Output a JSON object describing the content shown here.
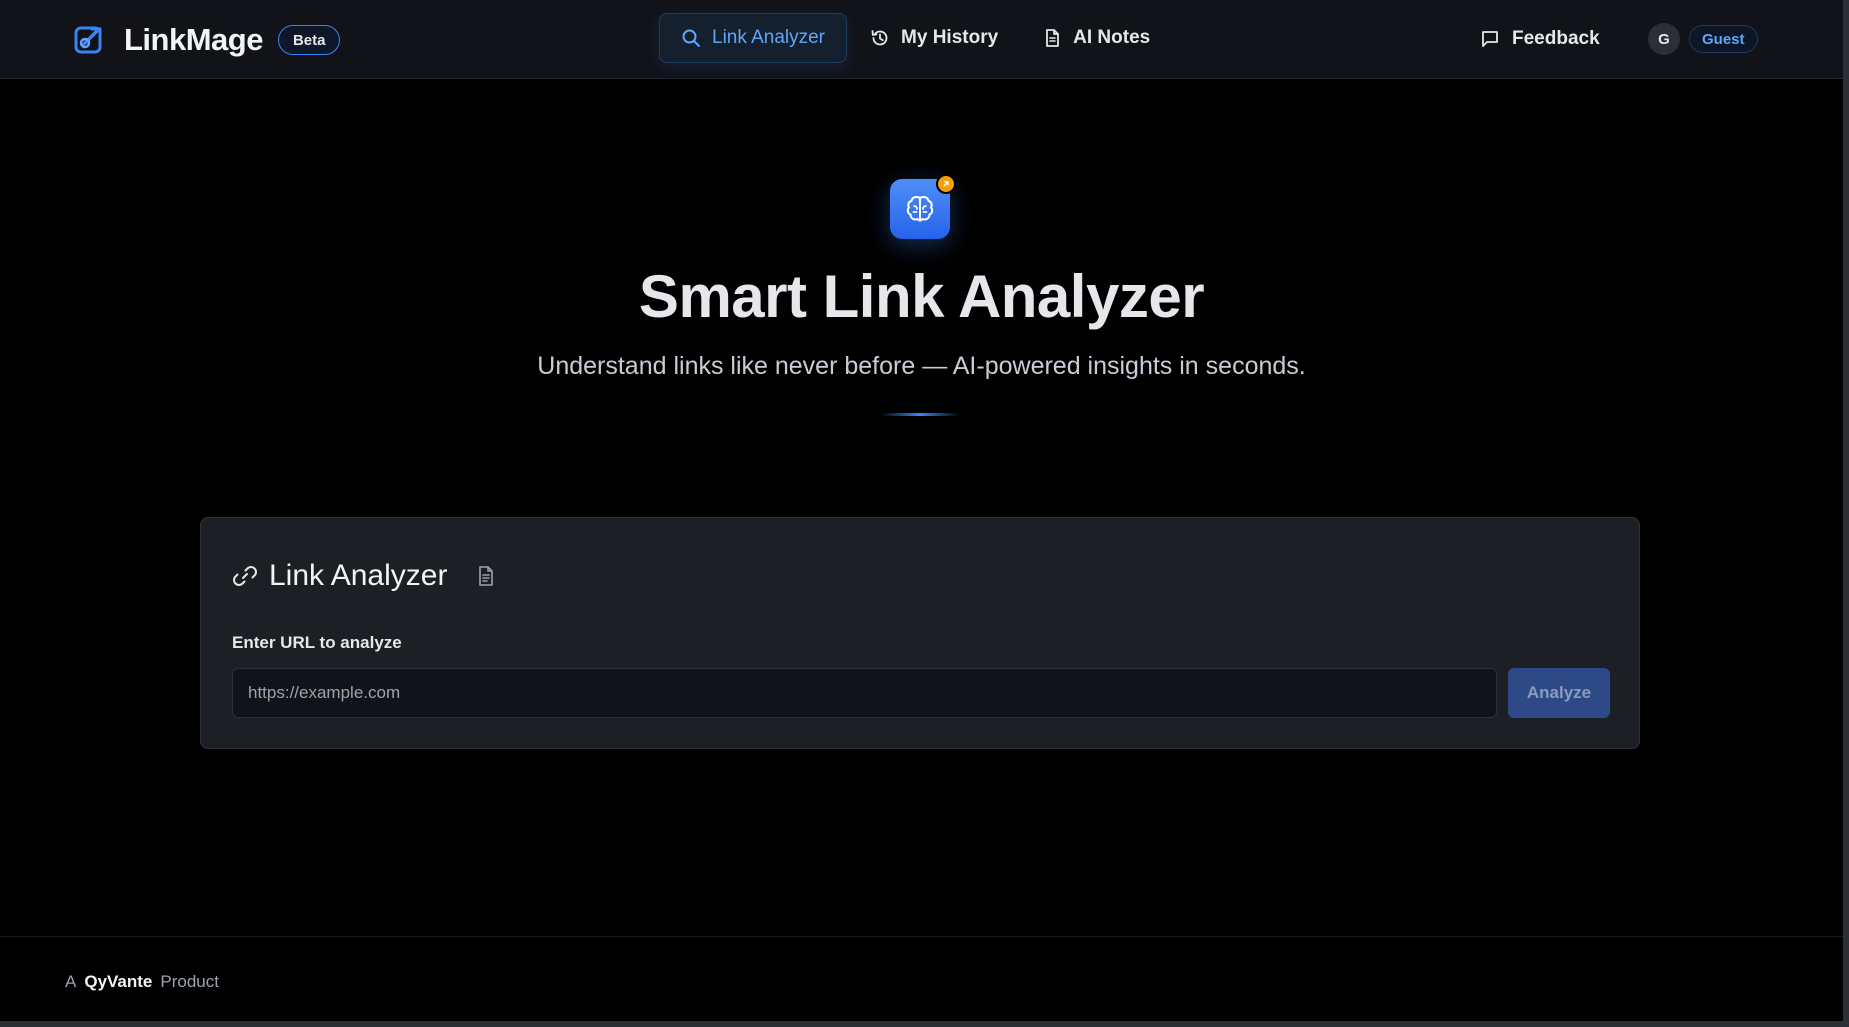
{
  "header": {
    "brand_name": "LinkMage",
    "beta_label": "Beta",
    "nav": [
      {
        "label": "Link Analyzer",
        "icon": "search-icon",
        "active": true
      },
      {
        "label": "My History",
        "icon": "history-icon",
        "active": false
      },
      {
        "label": "AI Notes",
        "icon": "document-icon",
        "active": false
      }
    ],
    "feedback_label": "Feedback",
    "user": {
      "avatar_initial": "G",
      "role_label": "Guest"
    }
  },
  "hero": {
    "icon": "brain-icon",
    "badge_icon": "link-icon",
    "title": "Smart Link Analyzer",
    "subtitle": "Understand links like never before — AI-powered insights in seconds."
  },
  "card": {
    "title": "Link Analyzer",
    "title_icon": "link-icon",
    "notes_icon": "document-icon",
    "url_label": "Enter URL to analyze",
    "url_value": "",
    "url_placeholder": "https://example.com",
    "analyze_label": "Analyze"
  },
  "footer": {
    "prefix": "A",
    "company": "QyVante",
    "suffix": "Product"
  },
  "colors": {
    "accent": "#3b82f6",
    "accent_text": "#60a5fa",
    "background": "#000000",
    "header_bg": "#111318",
    "card_bg": "#1c1f24",
    "hero_badge": "#f59e0b",
    "button_bg": "#2d4a86"
  }
}
